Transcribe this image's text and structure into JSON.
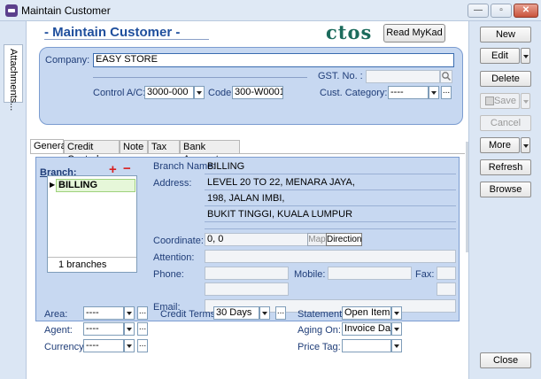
{
  "window": {
    "title": "Maintain Customer",
    "minimize": "—",
    "maximize": "▫",
    "close": "✕"
  },
  "sidebar": {
    "attachments_label": "Attachments..."
  },
  "header": {
    "title": "- Maintain Customer -",
    "ctos_logo": "ctos",
    "read_mykad": "Read MyKad"
  },
  "company_panel": {
    "company_label": "Company:",
    "company_value": "EASY STORE",
    "gst_label": "GST. No. :",
    "gst_value": "",
    "control_ac_label": "Control A/C:",
    "control_ac_value": "3000-000",
    "code_label": "Code:",
    "code_value": "300-W0001",
    "cust_category_label": "Cust. Category:",
    "cust_category_value": "----"
  },
  "tabs": [
    {
      "label": "General"
    },
    {
      "label": "Credit Control"
    },
    {
      "label": "Note"
    },
    {
      "label": "Tax"
    },
    {
      "label": "Bank Account"
    }
  ],
  "general": {
    "branch_label": "Branch:",
    "branch_selected": "BILLING",
    "branch_count": "1 branches",
    "branch_name_label": "Branch Name:",
    "branch_name_value": "BILLING",
    "address_label": "Address:",
    "address_lines": [
      "LEVEL 20 TO 22, MENARA JAYA,",
      "198, JALAN IMBI,",
      "BUKIT TINGGI, KUALA LUMPUR"
    ],
    "coordinate_label": "Coordinate:",
    "coordinate_value": "0, 0",
    "map_button": "Map",
    "direction_button": "Direction",
    "attention_label": "Attention:",
    "phone_label": "Phone:",
    "mobile_label": "Mobile:",
    "fax_label": "Fax:",
    "email_label": "Email:"
  },
  "bottom": {
    "area_label": "Area:",
    "area_value": "----",
    "agent_label": "Agent:",
    "agent_value": "----",
    "currency_label": "Currency:",
    "currency_value": "----",
    "credit_terms_label": "Credit Terms:",
    "credit_terms_value": "30 Days",
    "statement_label": "Statement:",
    "statement_value": "Open Item",
    "aging_on_label": "Aging On:",
    "aging_on_value": "Invoice Date",
    "price_tag_label": "Price Tag:",
    "price_tag_value": ""
  },
  "actions": {
    "new": "New",
    "edit": "Edit",
    "delete": "Delete",
    "save": "Save",
    "cancel": "Cancel",
    "more": "More",
    "refresh": "Refresh",
    "browse": "Browse",
    "close": "Close"
  },
  "colors": {
    "heading": "#1f4f9d",
    "panel": "#c7d8f1",
    "panel_border": "#7b9cd0",
    "ctos": "#1c6b5c",
    "plus_minus": "#d82020"
  },
  "icons": [
    "app-icon",
    "minimize-icon",
    "maximize-icon",
    "close-icon",
    "search-icon",
    "plus-icon",
    "minus-icon",
    "save-icon",
    "row-pointer-icon",
    "collapse-arrow-icon"
  ]
}
